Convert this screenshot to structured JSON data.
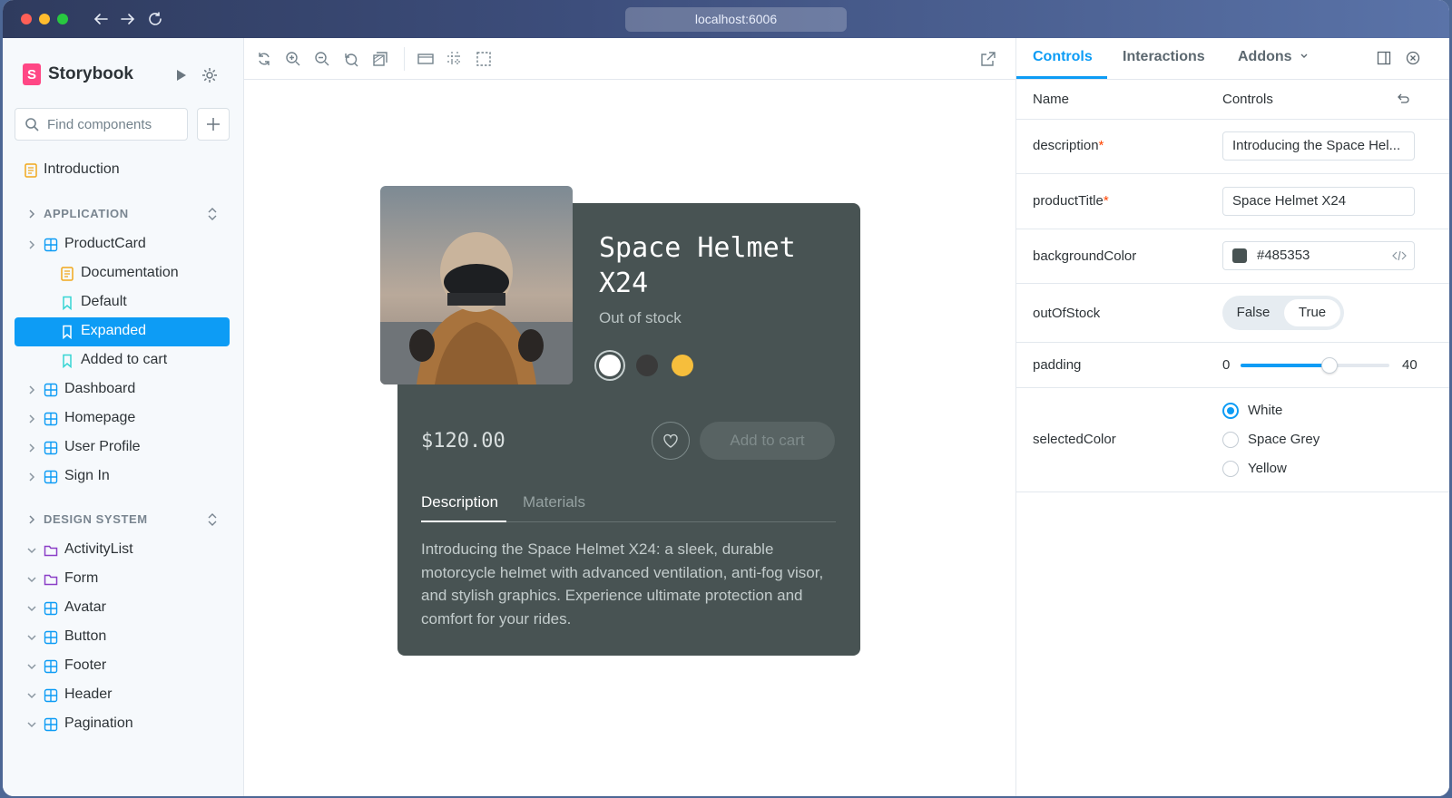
{
  "browser": {
    "url": "localhost:6006"
  },
  "sidebar": {
    "brand": "Storybook",
    "search_placeholder": "Find components",
    "intro": "Introduction",
    "sections": [
      {
        "label": "APPLICATION"
      },
      {
        "label": "DESIGN SYSTEM"
      }
    ],
    "application_items": [
      {
        "label": "ProductCard",
        "icon": "component-icon",
        "expanded": true
      },
      {
        "label": "Documentation",
        "icon": "docs-icon"
      },
      {
        "label": "Default",
        "icon": "story-icon"
      },
      {
        "label": "Expanded",
        "icon": "story-icon",
        "selected": true
      },
      {
        "label": "Added to cart",
        "icon": "story-icon"
      },
      {
        "label": "Dashboard",
        "icon": "component-icon"
      },
      {
        "label": "Homepage",
        "icon": "component-icon"
      },
      {
        "label": "User Profile",
        "icon": "component-icon"
      },
      {
        "label": "Sign In",
        "icon": "component-icon"
      }
    ],
    "design_items": [
      {
        "label": "ActivityList",
        "icon": "folder-icon"
      },
      {
        "label": "Form",
        "icon": "folder-icon"
      },
      {
        "label": "Avatar",
        "icon": "component-icon"
      },
      {
        "label": "Button",
        "icon": "component-icon"
      },
      {
        "label": "Footer",
        "icon": "component-icon"
      },
      {
        "label": "Header",
        "icon": "component-icon"
      },
      {
        "label": "Pagination",
        "icon": "component-icon"
      }
    ]
  },
  "product": {
    "title": "Space Helmet X24",
    "stock": "Out of stock",
    "price": "$120.00",
    "add_to_cart": "Add to cart",
    "tabs": [
      "Description",
      "Materials"
    ],
    "description": "Introducing the Space Helmet X24: a sleek, durable motorcycle helmet with advanced ventilation, anti-fog visor, and stylish graphics. Experience ultimate protection and comfort for your rides.",
    "swatches": [
      "#ffffff",
      "#3a3a3a",
      "#f6be3c"
    ],
    "background": "#485353"
  },
  "panel": {
    "tabs": [
      "Controls",
      "Interactions",
      "Addons"
    ],
    "header_name": "Name",
    "header_controls": "Controls",
    "rows": {
      "description": {
        "name": "description",
        "value": "Introducing the Space Hel..."
      },
      "productTitle": {
        "name": "productTitle",
        "value": "Space Helmet X24"
      },
      "backgroundColor": {
        "name": "backgroundColor",
        "value": "#485353"
      },
      "outOfStock": {
        "name": "outOfStock",
        "false_label": "False",
        "true_label": "True",
        "selected": "True"
      },
      "padding": {
        "name": "padding",
        "min": "0",
        "max": "40",
        "value_fraction": 0.6
      },
      "selectedColor": {
        "name": "selectedColor",
        "options": [
          "White",
          "Space Grey",
          "Yellow"
        ],
        "selected": "White"
      }
    },
    "required_mark": "*"
  },
  "colors": {
    "accent": "#0d9cf5",
    "brand": "#ff4785"
  }
}
